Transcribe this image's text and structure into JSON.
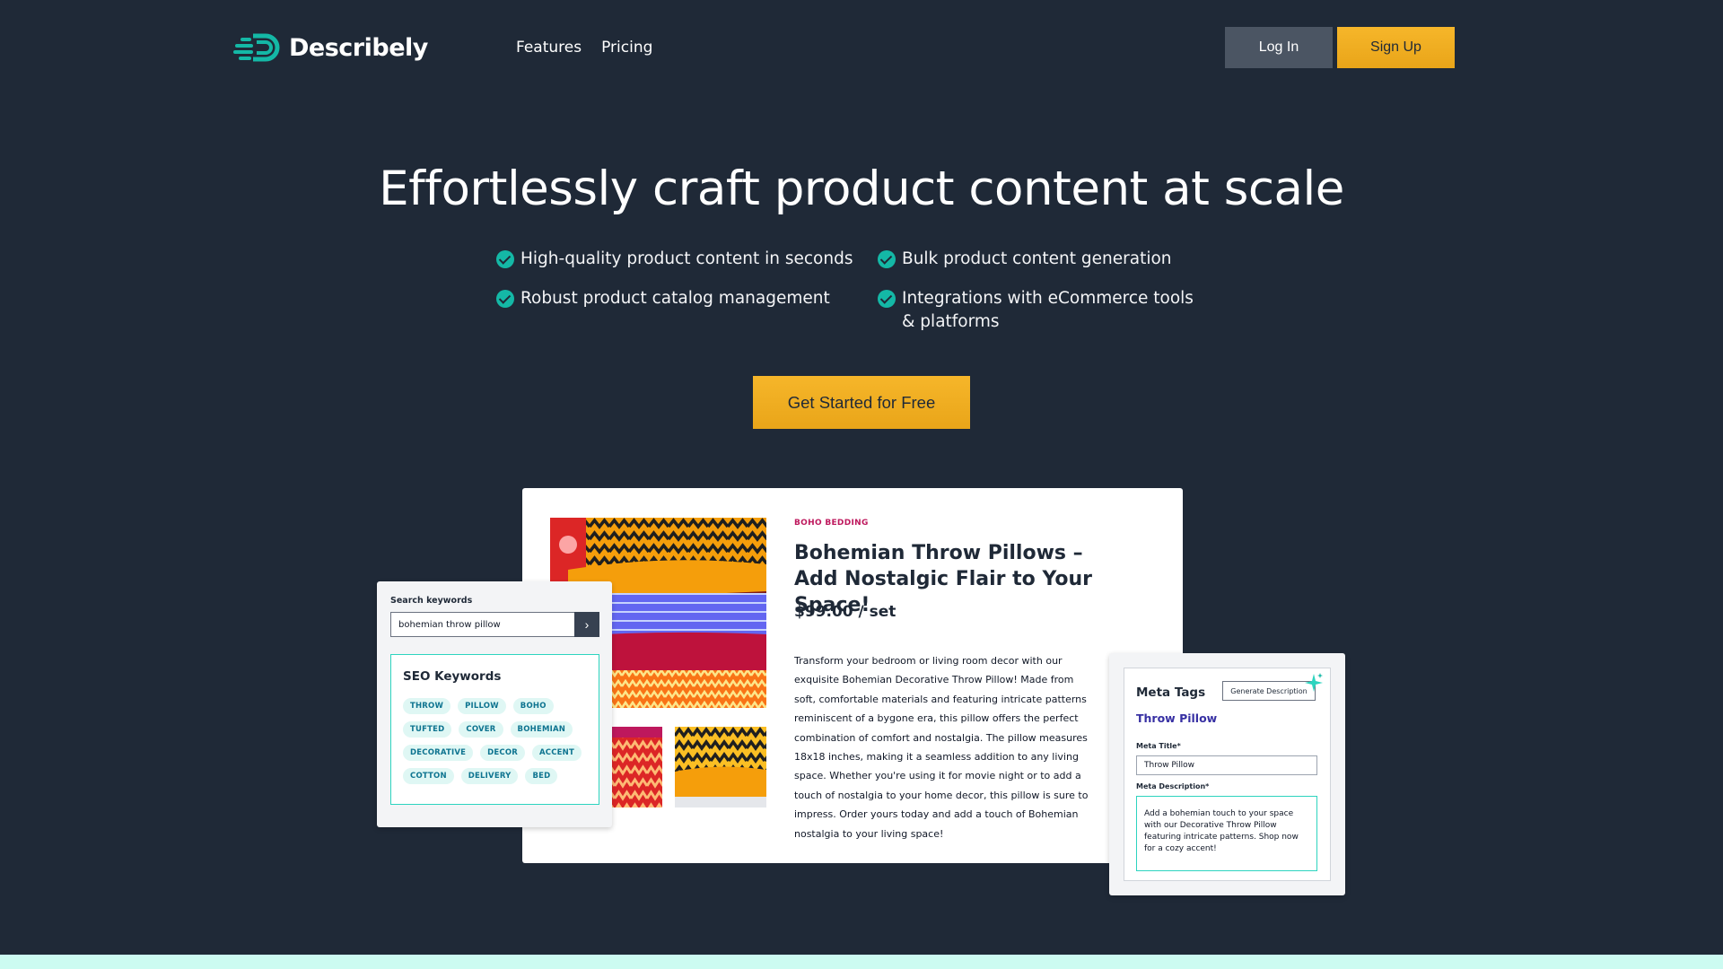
{
  "brand": {
    "name": "Describely",
    "accent": "#14b8a6",
    "cta_color": "#f0ad20",
    "background": "#1f2937"
  },
  "nav": {
    "links": [
      "Features",
      "Pricing"
    ],
    "login_label": "Log In",
    "signup_label": "Sign Up"
  },
  "hero": {
    "title": "Effortlessly craft product content at scale",
    "features": [
      "High-quality product content in seconds",
      "Bulk product content generation",
      "Robust product catalog management",
      "Integrations with eCommerce tools & platforms"
    ],
    "cta_label": "Get Started for Free"
  },
  "product": {
    "category": "BOHO BEDDING",
    "title_line1": "Bohemian Throw Pillows –",
    "title_line2": "Add Nostalgic Flair to Your Space!",
    "price": "$99.00 / set",
    "description": "Transform your bedroom or living room decor with our exquisite Bohemian Decorative Throw Pillow! Made from soft, comfortable materials and featuring intricate patterns reminiscent of a bygone era, this pillow offers the perfect combination of comfort and nostalgia. The pillow measures 18x18 inches, making it a seamless addition to any living space. Whether you're using it for movie night or to add a touch of nostalgia to your home decor, this pillow is sure to impress. Order yours today and add a touch of Bohemian nostalgia to your living space!"
  },
  "seo": {
    "search_label": "Search keywords",
    "search_value": "bohemian throw pillow",
    "search_icon": "chevron-right-icon",
    "keywords_title": "SEO Keywords",
    "keywords": [
      "THROW",
      "PILLOW",
      "BOHO",
      "TUFTED",
      "COVER",
      "BOHEMIAN",
      "DECORATIVE",
      "DECOR",
      "ACCENT",
      "COTTON",
      "DELIVERY",
      "BED"
    ]
  },
  "meta": {
    "title": "Meta Tags",
    "generate_label": "Generate Description",
    "product_name": "Throw Pillow",
    "meta_title_label": "Meta Title*",
    "meta_title_value": "Throw Pillow",
    "meta_desc_label": "Meta Description*",
    "meta_desc_value": "Add a bohemian touch to your space with our Decorative Throw Pillow featuring intricate patterns. Shop now for a cozy accent!"
  }
}
